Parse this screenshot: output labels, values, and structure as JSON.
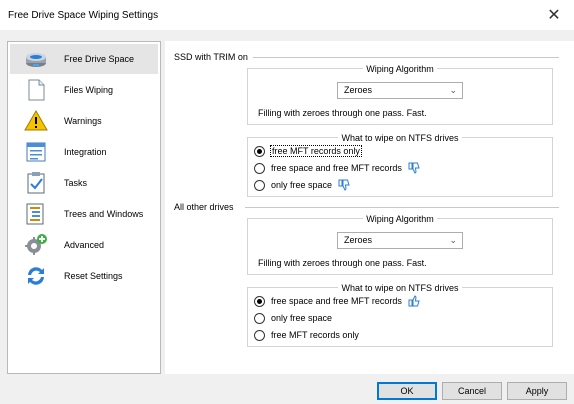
{
  "window": {
    "title": "Free Drive Space Wiping Settings",
    "close_glyph": "✕"
  },
  "sidebar": {
    "items": [
      {
        "label": "Free Drive Space",
        "icon": "drive-icon",
        "selected": true
      },
      {
        "label": "Files Wiping",
        "icon": "file-icon",
        "selected": false
      },
      {
        "label": "Warnings",
        "icon": "warning-icon",
        "selected": false
      },
      {
        "label": "Integration",
        "icon": "integration-icon",
        "selected": false
      },
      {
        "label": "Tasks",
        "icon": "tasks-icon",
        "selected": false
      },
      {
        "label": "Trees and Windows",
        "icon": "trees-icon",
        "selected": false
      },
      {
        "label": "Advanced",
        "icon": "gear-plus-icon",
        "selected": false
      },
      {
        "label": "Reset Settings",
        "icon": "refresh-icon",
        "selected": false
      }
    ]
  },
  "ssd": {
    "heading": "SSD with TRIM on",
    "algorithm": {
      "title": "Wiping Algorithm",
      "selected": "Zeroes",
      "description": "Filling with zeroes through one pass. Fast."
    },
    "ntfs": {
      "title": "What to wipe on NTFS drives",
      "options": [
        {
          "label": "free MFT records only",
          "checked": true,
          "thumb": ""
        },
        {
          "label": "free space and free MFT records",
          "checked": false,
          "thumb": "thumbs-down-icon"
        },
        {
          "label": "only free space",
          "checked": false,
          "thumb": "thumbs-down-icon"
        }
      ]
    }
  },
  "other": {
    "heading": "All other drives",
    "algorithm": {
      "title": "Wiping Algorithm",
      "selected": "Zeroes",
      "description": "Filling with zeroes through one pass. Fast."
    },
    "ntfs": {
      "title": "What to wipe on NTFS drives",
      "options": [
        {
          "label": "free space and free MFT records",
          "checked": true,
          "thumb": "thumbs-up-icon"
        },
        {
          "label": "only free space",
          "checked": false,
          "thumb": ""
        },
        {
          "label": "free MFT records only",
          "checked": false,
          "thumb": ""
        }
      ]
    }
  },
  "footer": {
    "ok": "OK",
    "cancel": "Cancel",
    "apply": "Apply"
  },
  "colors": {
    "accent": "#0078d7",
    "thumb": "#2a7fd4",
    "sidebar_selected": "#e5e5e5"
  }
}
